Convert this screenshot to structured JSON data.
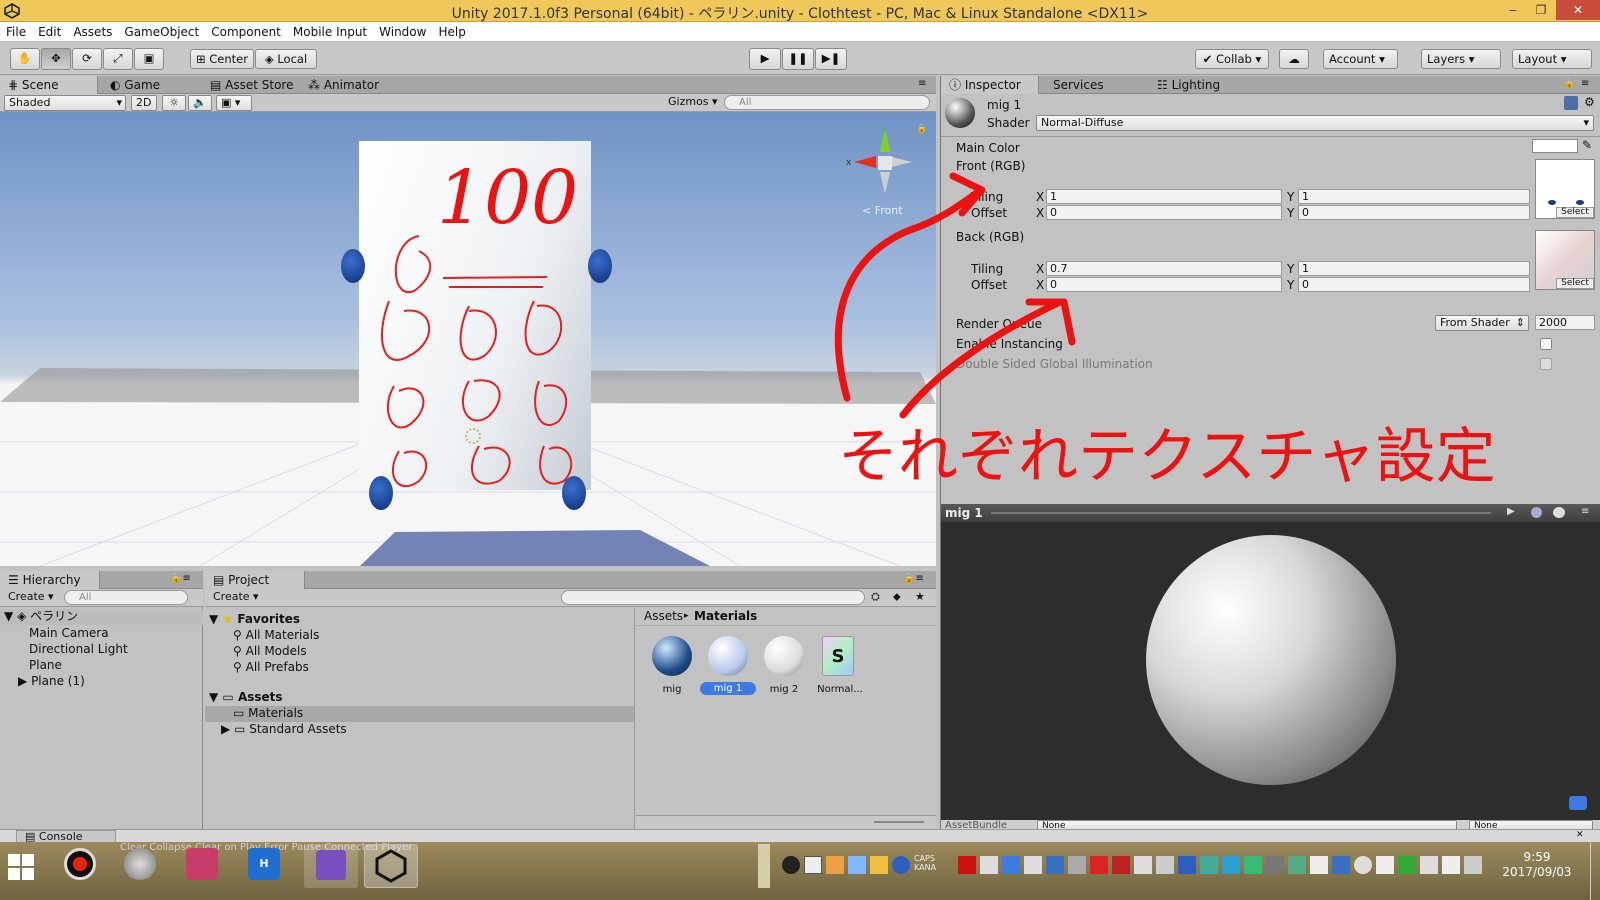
{
  "window": {
    "title": "Unity 2017.1.0f3 Personal (64bit) - ペラリン.unity - Clothtest - PC, Mac & Linux Standalone <DX11>",
    "minimize": "‒",
    "restore": "❐",
    "close": "✕"
  },
  "menu": [
    "File",
    "Edit",
    "Assets",
    "GameObject",
    "Component",
    "Mobile Input",
    "Window",
    "Help"
  ],
  "toolbar": {
    "center": "Center",
    "local": "Local",
    "collab": "Collab",
    "account": "Account",
    "layers": "Layers",
    "layout": "Layout"
  },
  "scene": {
    "tabs": [
      "Scene",
      "Game",
      "Asset Store",
      "Animator"
    ],
    "shading": "Shaded",
    "mode2d": "2D",
    "gizmos": "Gizmos",
    "search_placeholder": "All",
    "front_label": "Front",
    "cloth_text": "100"
  },
  "inspector": {
    "tabs": [
      "Inspector",
      "Services",
      "Lighting"
    ],
    "material_name": "mig 1",
    "shader_label": "Shader",
    "shader_value": "Normal-Diffuse",
    "main_color": "Main Color",
    "front_label": "Front (RGB)",
    "tiling_label": "Tiling",
    "offset_label": "Offset",
    "front_tiling": {
      "x": "1",
      "y": "1"
    },
    "front_offset": {
      "x": "0",
      "y": "0"
    },
    "back_label": "Back (RGB)",
    "back_tiling": {
      "x": "0.7",
      "y": "1"
    },
    "back_offset": {
      "x": "0",
      "y": "0"
    },
    "select": "Select",
    "render_queue": "Render Queue",
    "render_queue_mode": "From Shader",
    "render_queue_value": "2000",
    "enable_instancing": "Enable Instancing",
    "double_sided_gi": "Double Sided Global Illumination",
    "x": "X",
    "y": "Y"
  },
  "preview": {
    "title": "mig 1",
    "assetbundle": "AssetBundle",
    "none": "None"
  },
  "annotation": "それぞれテクスチャ設定",
  "hierarchy": {
    "tab": "Hierarchy",
    "create": "Create",
    "search_placeholder": "All",
    "scene": "ペラリン",
    "items": [
      "Main Camera",
      "Directional Light",
      "Plane",
      "Plane (1)"
    ]
  },
  "project": {
    "tab": "Project",
    "create": "Create",
    "favorites": "Favorites",
    "fav_items": [
      "All Materials",
      "All Models",
      "All Prefabs"
    ],
    "assets": "Assets",
    "asset_items": [
      "Materials",
      "Standard Assets"
    ],
    "breadcrumb_root": "Assets",
    "breadcrumb_leaf": "Materials",
    "files": [
      "mig",
      "mig 1",
      "mig 2",
      "Normal..."
    ]
  },
  "console": {
    "tab": "Console",
    "toolbar": [
      "Clear",
      "Collapse",
      "Clear on Play",
      "Error Pause",
      "Connected Player"
    ]
  },
  "taskbar": {
    "time": "9:59",
    "date": "2017/09/03",
    "caps": "CAPS",
    "kana": "KANA"
  },
  "colors": {
    "title_bar": "#f0c85a",
    "annotation_red": "#ee1111",
    "selection_blue": "#3d7be0"
  }
}
